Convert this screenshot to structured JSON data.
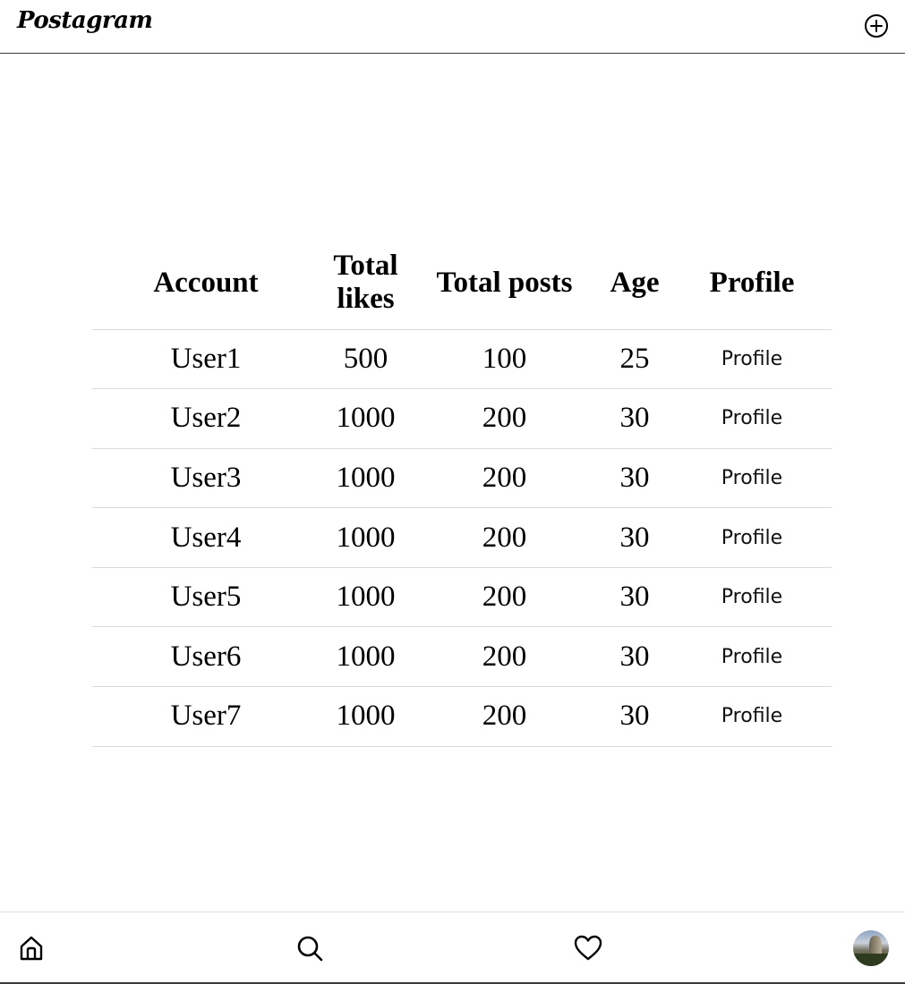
{
  "header": {
    "brand": "Postagram",
    "add_icon": "plus-circle-icon"
  },
  "table": {
    "headers": [
      "Account",
      "Total likes",
      "Total posts",
      "Age",
      "Profile"
    ],
    "rows": [
      {
        "account": "User1",
        "likes": "500",
        "posts": "100",
        "age": "25",
        "profile": "Profile"
      },
      {
        "account": "User2",
        "likes": "1000",
        "posts": "200",
        "age": "30",
        "profile": "Profile"
      },
      {
        "account": "User3",
        "likes": "1000",
        "posts": "200",
        "age": "30",
        "profile": "Profile"
      },
      {
        "account": "User4",
        "likes": "1000",
        "posts": "200",
        "age": "30",
        "profile": "Profile"
      },
      {
        "account": "User5",
        "likes": "1000",
        "posts": "200",
        "age": "30",
        "profile": "Profile"
      },
      {
        "account": "User6",
        "likes": "1000",
        "posts": "200",
        "age": "30",
        "profile": "Profile"
      },
      {
        "account": "User7",
        "likes": "1000",
        "posts": "200",
        "age": "30",
        "profile": "Profile"
      }
    ]
  },
  "bottom_nav": {
    "items": [
      "home-icon",
      "search-icon",
      "heart-icon",
      "avatar"
    ]
  },
  "colors": {
    "text": "#000000",
    "divider": "#d9d9d9",
    "header_border": "#3a3a3a"
  }
}
